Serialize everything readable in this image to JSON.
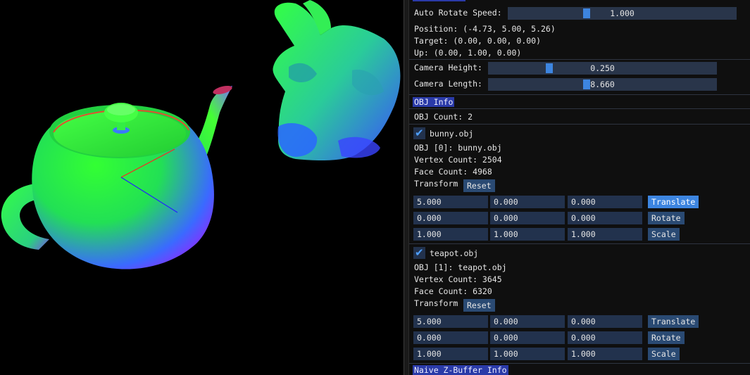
{
  "settings": {
    "auto_rotate_label": "Auto Rotate Speed:",
    "auto_rotate_value": "1.000",
    "auto_rotate_fraction": 0.34,
    "position_text": "Position: (-4.73, 5.00, 5.26)",
    "target_text": "Target: (0.00, 0.00, 0.00)",
    "up_text": "Up: (0.00, 1.00, 0.00)",
    "camera_height_label": "Camera Height:",
    "camera_height_value": "0.250",
    "camera_height_fraction": 0.26,
    "camera_length_label": "Camera Length:",
    "camera_length_value": "8.660",
    "camera_length_fraction": 0.43
  },
  "obj_info": {
    "header": "OBJ Info",
    "count_text": "OBJ Count: 2",
    "objects": [
      {
        "name": "bunny.obj",
        "enabled": true,
        "title": "OBJ [0]: bunny.obj",
        "vertex_count": "Vertex Count: 2504",
        "face_count": "Face Count: 4968",
        "transform_label": "Transform",
        "reset_label": "Reset",
        "rows": [
          {
            "values": [
              "5.000",
              "0.000",
              "0.000"
            ],
            "button": "Translate",
            "active": true
          },
          {
            "values": [
              "0.000",
              "0.000",
              "0.000"
            ],
            "button": "Rotate",
            "active": false
          },
          {
            "values": [
              "1.000",
              "1.000",
              "1.000"
            ],
            "button": "Scale",
            "active": false
          }
        ]
      },
      {
        "name": "teapot.obj",
        "enabled": true,
        "title": "OBJ [1]: teapot.obj",
        "vertex_count": "Vertex Count: 3645",
        "face_count": "Face Count: 6320",
        "transform_label": "Transform",
        "reset_label": "Reset",
        "rows": [
          {
            "values": [
              "5.000",
              "0.000",
              "0.000"
            ],
            "button": "Translate",
            "active": false
          },
          {
            "values": [
              "0.000",
              "0.000",
              "0.000"
            ],
            "button": "Rotate",
            "active": false
          },
          {
            "values": [
              "1.000",
              "1.000",
              "1.000"
            ],
            "button": "Scale",
            "active": false
          }
        ]
      }
    ]
  },
  "zbuffer_header": "Naive Z-Buffer Info",
  "colors": {
    "panel_bg": "#0f0f0f",
    "header_bg": "#2a3aa8",
    "field_bg": "#22324d",
    "button_bg": "#2a4a73",
    "accent": "#3d85e0"
  }
}
